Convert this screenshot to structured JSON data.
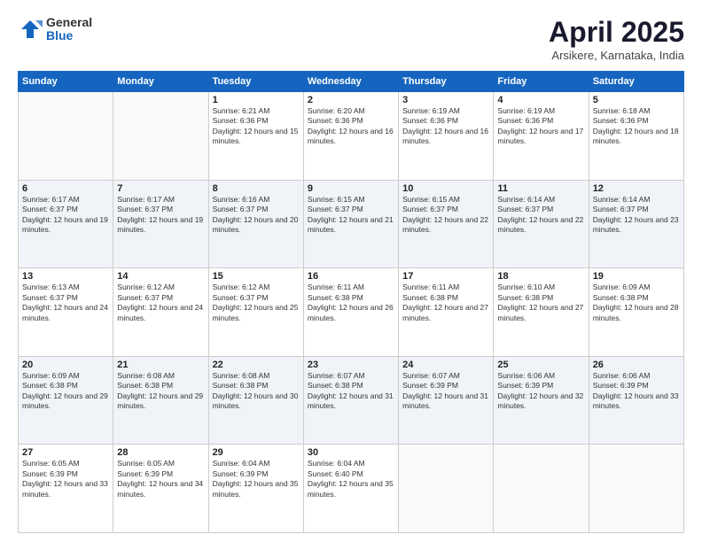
{
  "header": {
    "logo_general": "General",
    "logo_blue": "Blue",
    "title": "April 2025",
    "location": "Arsikere, Karnataka, India"
  },
  "weekdays": [
    "Sunday",
    "Monday",
    "Tuesday",
    "Wednesday",
    "Thursday",
    "Friday",
    "Saturday"
  ],
  "weeks": [
    [
      {
        "day": "",
        "info": ""
      },
      {
        "day": "",
        "info": ""
      },
      {
        "day": "1",
        "info": "Sunrise: 6:21 AM\nSunset: 6:36 PM\nDaylight: 12 hours and 15 minutes."
      },
      {
        "day": "2",
        "info": "Sunrise: 6:20 AM\nSunset: 6:36 PM\nDaylight: 12 hours and 16 minutes."
      },
      {
        "day": "3",
        "info": "Sunrise: 6:19 AM\nSunset: 6:36 PM\nDaylight: 12 hours and 16 minutes."
      },
      {
        "day": "4",
        "info": "Sunrise: 6:19 AM\nSunset: 6:36 PM\nDaylight: 12 hours and 17 minutes."
      },
      {
        "day": "5",
        "info": "Sunrise: 6:18 AM\nSunset: 6:36 PM\nDaylight: 12 hours and 18 minutes."
      }
    ],
    [
      {
        "day": "6",
        "info": "Sunrise: 6:17 AM\nSunset: 6:37 PM\nDaylight: 12 hours and 19 minutes."
      },
      {
        "day": "7",
        "info": "Sunrise: 6:17 AM\nSunset: 6:37 PM\nDaylight: 12 hours and 19 minutes."
      },
      {
        "day": "8",
        "info": "Sunrise: 6:16 AM\nSunset: 6:37 PM\nDaylight: 12 hours and 20 minutes."
      },
      {
        "day": "9",
        "info": "Sunrise: 6:15 AM\nSunset: 6:37 PM\nDaylight: 12 hours and 21 minutes."
      },
      {
        "day": "10",
        "info": "Sunrise: 6:15 AM\nSunset: 6:37 PM\nDaylight: 12 hours and 22 minutes."
      },
      {
        "day": "11",
        "info": "Sunrise: 6:14 AM\nSunset: 6:37 PM\nDaylight: 12 hours and 22 minutes."
      },
      {
        "day": "12",
        "info": "Sunrise: 6:14 AM\nSunset: 6:37 PM\nDaylight: 12 hours and 23 minutes."
      }
    ],
    [
      {
        "day": "13",
        "info": "Sunrise: 6:13 AM\nSunset: 6:37 PM\nDaylight: 12 hours and 24 minutes."
      },
      {
        "day": "14",
        "info": "Sunrise: 6:12 AM\nSunset: 6:37 PM\nDaylight: 12 hours and 24 minutes."
      },
      {
        "day": "15",
        "info": "Sunrise: 6:12 AM\nSunset: 6:37 PM\nDaylight: 12 hours and 25 minutes."
      },
      {
        "day": "16",
        "info": "Sunrise: 6:11 AM\nSunset: 6:38 PM\nDaylight: 12 hours and 26 minutes."
      },
      {
        "day": "17",
        "info": "Sunrise: 6:11 AM\nSunset: 6:38 PM\nDaylight: 12 hours and 27 minutes."
      },
      {
        "day": "18",
        "info": "Sunrise: 6:10 AM\nSunset: 6:38 PM\nDaylight: 12 hours and 27 minutes."
      },
      {
        "day": "19",
        "info": "Sunrise: 6:09 AM\nSunset: 6:38 PM\nDaylight: 12 hours and 28 minutes."
      }
    ],
    [
      {
        "day": "20",
        "info": "Sunrise: 6:09 AM\nSunset: 6:38 PM\nDaylight: 12 hours and 29 minutes."
      },
      {
        "day": "21",
        "info": "Sunrise: 6:08 AM\nSunset: 6:38 PM\nDaylight: 12 hours and 29 minutes."
      },
      {
        "day": "22",
        "info": "Sunrise: 6:08 AM\nSunset: 6:38 PM\nDaylight: 12 hours and 30 minutes."
      },
      {
        "day": "23",
        "info": "Sunrise: 6:07 AM\nSunset: 6:38 PM\nDaylight: 12 hours and 31 minutes."
      },
      {
        "day": "24",
        "info": "Sunrise: 6:07 AM\nSunset: 6:39 PM\nDaylight: 12 hours and 31 minutes."
      },
      {
        "day": "25",
        "info": "Sunrise: 6:06 AM\nSunset: 6:39 PM\nDaylight: 12 hours and 32 minutes."
      },
      {
        "day": "26",
        "info": "Sunrise: 6:06 AM\nSunset: 6:39 PM\nDaylight: 12 hours and 33 minutes."
      }
    ],
    [
      {
        "day": "27",
        "info": "Sunrise: 6:05 AM\nSunset: 6:39 PM\nDaylight: 12 hours and 33 minutes."
      },
      {
        "day": "28",
        "info": "Sunrise: 6:05 AM\nSunset: 6:39 PM\nDaylight: 12 hours and 34 minutes."
      },
      {
        "day": "29",
        "info": "Sunrise: 6:04 AM\nSunset: 6:39 PM\nDaylight: 12 hours and 35 minutes."
      },
      {
        "day": "30",
        "info": "Sunrise: 6:04 AM\nSunset: 6:40 PM\nDaylight: 12 hours and 35 minutes."
      },
      {
        "day": "",
        "info": ""
      },
      {
        "day": "",
        "info": ""
      },
      {
        "day": "",
        "info": ""
      }
    ]
  ]
}
